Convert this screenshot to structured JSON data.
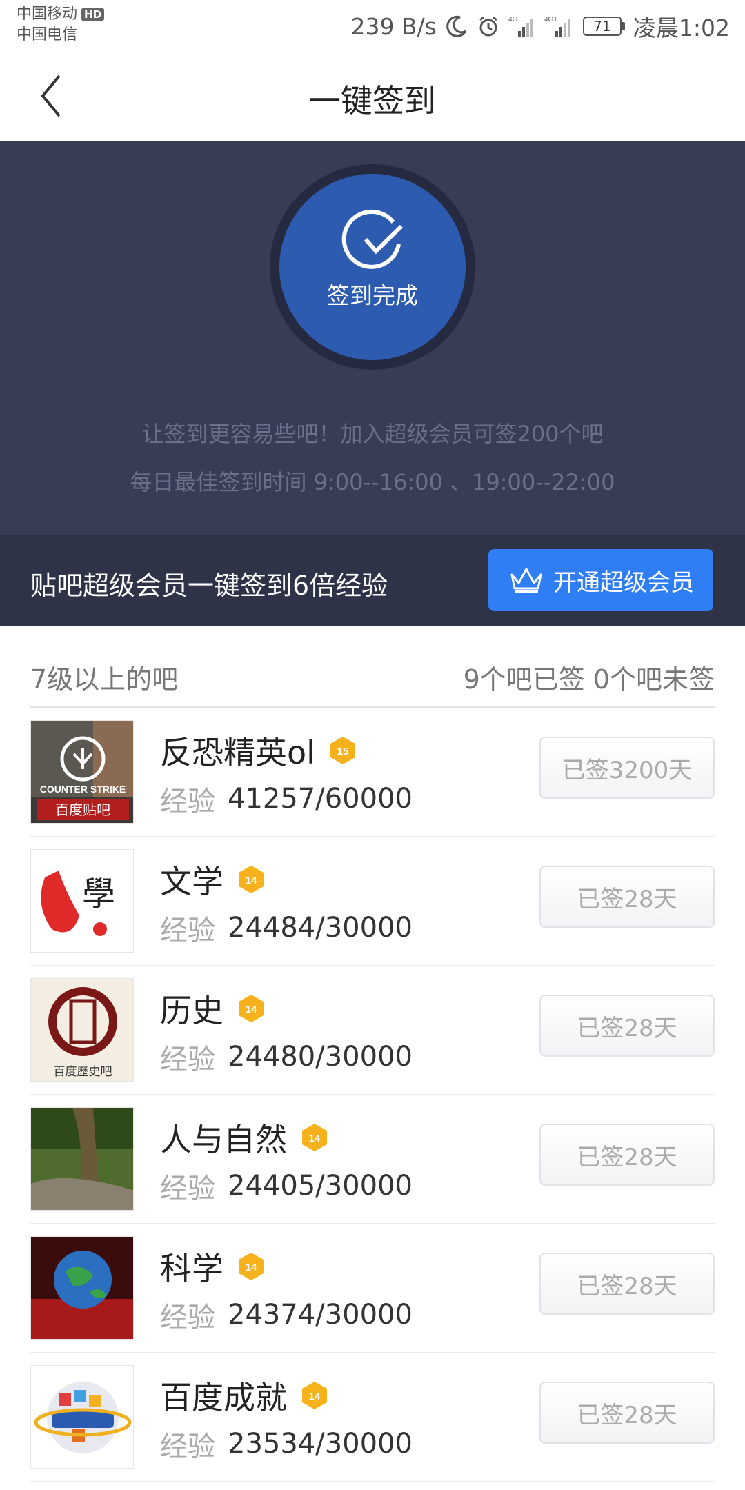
{
  "status_bar": {
    "carrier1": "中国移动",
    "hd": "HD",
    "carrier2": "中国电信",
    "speed": "239 B/s",
    "net1": "4G",
    "net2": "4G+",
    "battery": "71",
    "time": "凌晨1:02"
  },
  "header": {
    "title": "一键签到"
  },
  "hero": {
    "status_label": "签到完成",
    "line1": "让签到更容易些吧！加入超级会员可签200个吧",
    "line2": "每日最佳签到时间  9:00--16:00 、19:00--22:00"
  },
  "promo": {
    "text": "贴吧超级会员一键签到6倍经验",
    "button_label": "开通超级会员"
  },
  "list": {
    "title": "7级以上的吧",
    "summary": "9个吧已签 0个吧未签",
    "exp_label": "经验",
    "items": [
      {
        "name": "反恐精英ol",
        "level": "15",
        "exp": "41257/60000",
        "status": "已签3200天"
      },
      {
        "name": "文学",
        "level": "14",
        "exp": "24484/30000",
        "status": "已签28天"
      },
      {
        "name": "历史",
        "level": "14",
        "exp": "24480/30000",
        "status": "已签28天"
      },
      {
        "name": "人与自然",
        "level": "14",
        "exp": "24405/30000",
        "status": "已签28天"
      },
      {
        "name": "科学",
        "level": "14",
        "exp": "24374/30000",
        "status": "已签28天"
      },
      {
        "name": "百度成就",
        "level": "14",
        "exp": "23534/30000",
        "status": "已签28天"
      }
    ]
  },
  "avatar_texts": {
    "cs_line1": "COUNTER STRIKE",
    "cs_line2": "百度贴吧",
    "wenxue_char": "學",
    "lishi_caption": "百度歷史吧"
  },
  "colors": {
    "hero_bg": "#383c55",
    "promo_bg": "#2f3347",
    "accent_blue": "#2f7ef5",
    "ring_blue": "#2c5bb0",
    "badge_gold": "#f5b21c"
  }
}
